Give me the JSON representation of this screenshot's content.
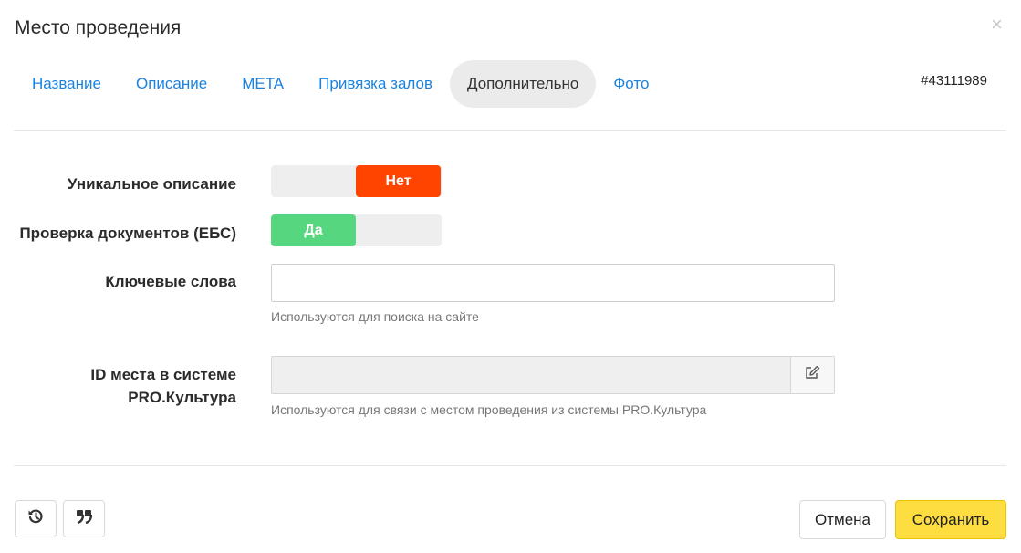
{
  "dialog": {
    "title": "Место проведения",
    "close_glyph": "×",
    "record_id": "#43111989"
  },
  "tabs": [
    {
      "label": "Название",
      "active": false
    },
    {
      "label": "Описание",
      "active": false
    },
    {
      "label": "META",
      "active": false
    },
    {
      "label": "Привязка залов",
      "active": false
    },
    {
      "label": "Дополнительно",
      "active": true
    },
    {
      "label": "Фото",
      "active": false
    }
  ],
  "form": {
    "unique_description": {
      "label": "Уникальное описание",
      "value_label": "Нет",
      "value": false
    },
    "document_check": {
      "label": "Проверка документов (ЕБС)",
      "value_label": "Да",
      "value": true
    },
    "keywords": {
      "label": "Ключевые слова",
      "value": "",
      "placeholder": "",
      "hint": "Используются для поиска на сайте"
    },
    "pro_culture_id": {
      "label_line1": "ID места в системе",
      "label_line2": "PRO.Культура",
      "value": "",
      "hint": "Используются для связи с местом проведения из системы PRO.Культура",
      "edit_icon": "edit-icon"
    }
  },
  "footer": {
    "history_icon": "history-icon",
    "quote_icon": "quote-icon",
    "cancel_label": "Отмена",
    "save_label": "Сохранить"
  },
  "colors": {
    "tab_link": "#1a83e0",
    "toggle_no": "#ff4400",
    "toggle_yes": "#56d67f",
    "save_button": "#fddd40"
  }
}
